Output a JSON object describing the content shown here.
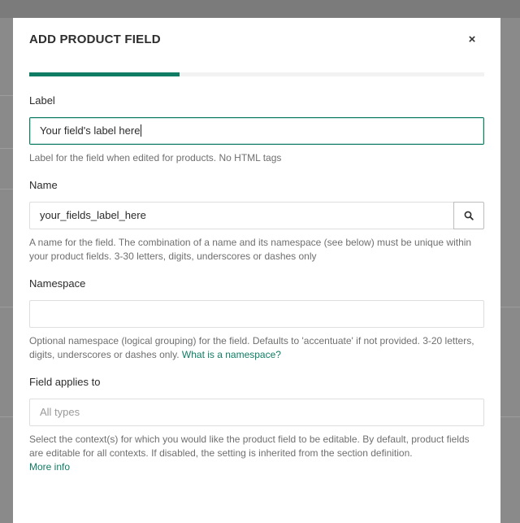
{
  "modal": {
    "title": "ADD PRODUCT FIELD",
    "close_glyph": "×",
    "progress_fraction": 0.33
  },
  "fields": {
    "label": {
      "title": "Label",
      "value": "Your field's label here",
      "help": "Label for the field when edited for products. No HTML tags"
    },
    "name": {
      "title": "Name",
      "value": "your_fields_label_here",
      "help": "A name for the field. The combination of a name and its namespace (see below) must be unique within your product fields. 3-30 letters, digits, underscores or dashes only"
    },
    "namespace": {
      "title": "Namespace",
      "value": "",
      "help": "Optional namespace (logical grouping) for the field. Defaults to 'accentuate' if not provided. 3-20 letters, digits, underscores or dashes only.",
      "link": "What is a namespace?"
    },
    "applies_to": {
      "title": "Field applies to",
      "placeholder": "All types",
      "help": "Select the context(s) for which you would like the product field to be editable. By default, product fields are editable for all contexts. If disabled, the setting is inherited from the section definition.",
      "link": "More info"
    }
  },
  "colors": {
    "accent": "#0e7d64",
    "backdrop": "#8a8a8a"
  },
  "icons": {
    "close": "close-icon",
    "search": "search-icon"
  }
}
